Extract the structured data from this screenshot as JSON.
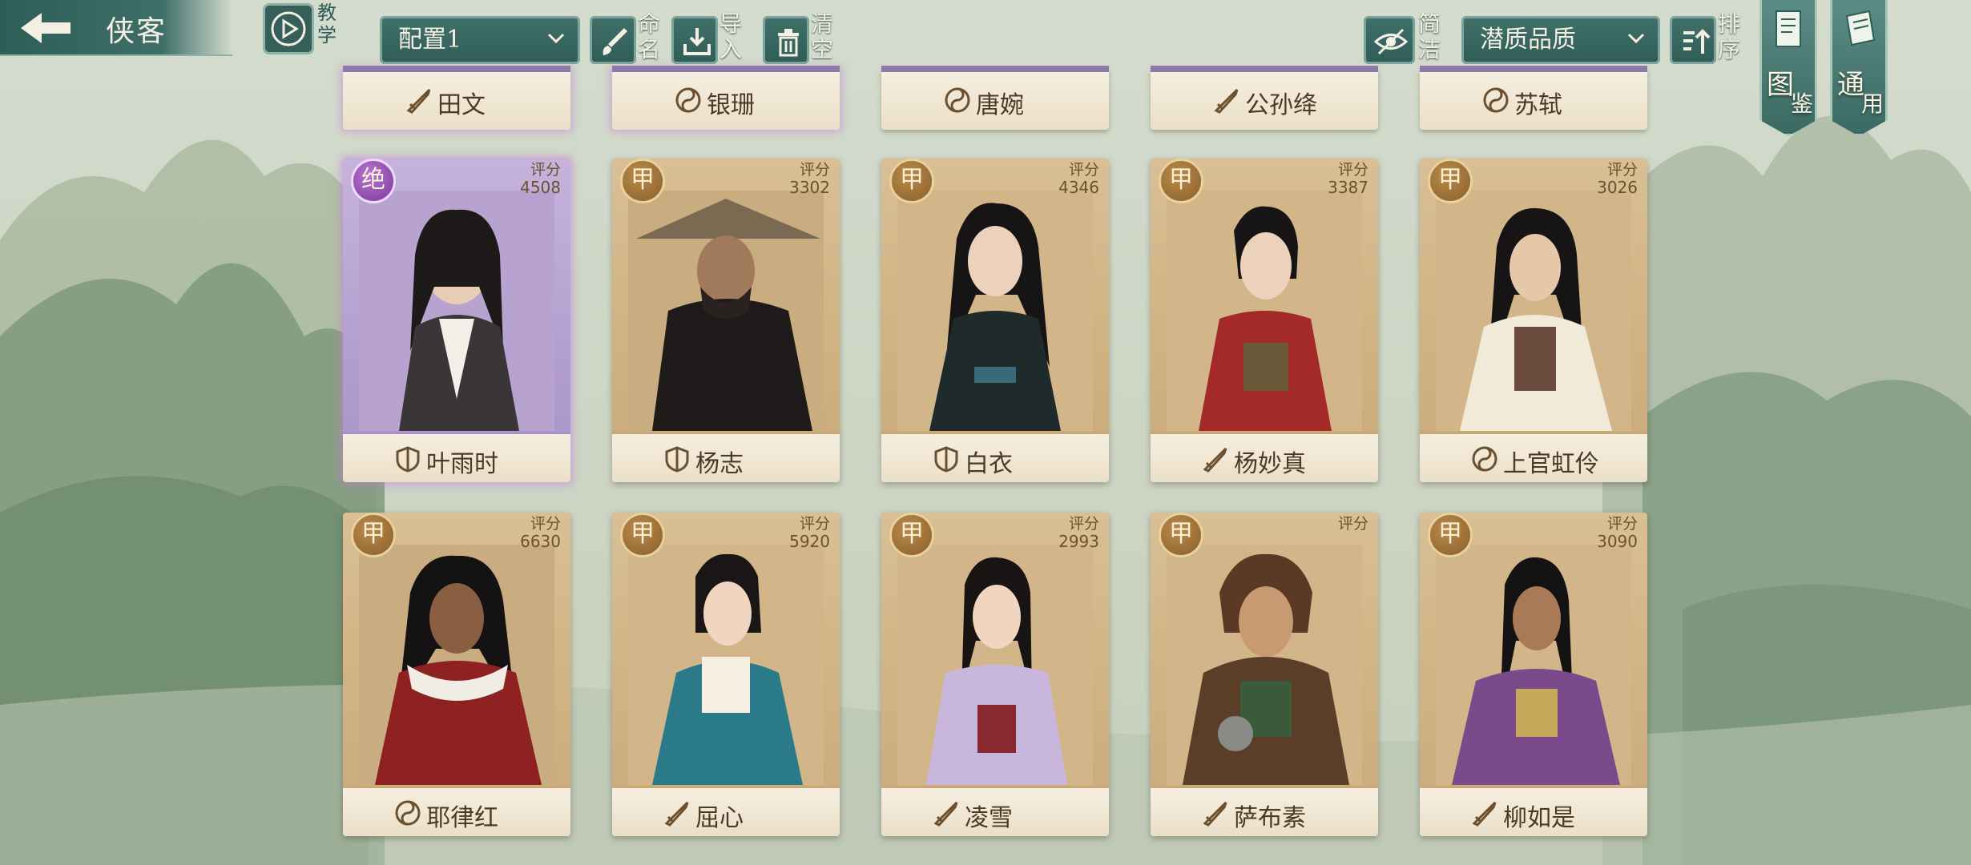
{
  "header": {
    "back_title": "侠客",
    "tutorial_label": "教学",
    "config_select": "配置1",
    "rename_label": "命名",
    "import_label": "导入",
    "clear_label": "清空",
    "simple_label": "简洁",
    "sort_select": "潜质品质",
    "sort_label": "排序",
    "atlas_label_1": "图",
    "atlas_label_2": "鉴",
    "general_label_1": "通",
    "general_label_2": "用"
  },
  "partial_row": [
    {
      "name": "田文",
      "icon": "sword-icon"
    },
    {
      "name": "银珊",
      "icon": "taiji-icon"
    },
    {
      "name": "唐婉",
      "icon": "taiji-icon"
    },
    {
      "name": "公孙绛",
      "icon": "sword-icon"
    },
    {
      "name": "苏轼",
      "icon": "taiji-icon"
    }
  ],
  "cards": [
    {
      "grade": "绝",
      "score_label": "评分",
      "score": "4508",
      "name": "叶雨时",
      "icon": "shield-icon",
      "rarity": "purple"
    },
    {
      "grade": "甲",
      "score_label": "评分",
      "score": "3302",
      "name": "杨志",
      "icon": "shield-icon",
      "rarity": "gold"
    },
    {
      "grade": "甲",
      "score_label": "评分",
      "score": "4346",
      "name": "白衣",
      "icon": "shield-icon",
      "rarity": "gold"
    },
    {
      "grade": "甲",
      "score_label": "评分",
      "score": "3387",
      "name": "杨妙真",
      "icon": "sword-icon",
      "rarity": "gold"
    },
    {
      "grade": "甲",
      "score_label": "评分",
      "score": "3026",
      "name": "上官虹伶",
      "icon": "taiji-icon",
      "rarity": "gold"
    },
    {
      "grade": "甲",
      "score_label": "评分",
      "score": "6630",
      "name": "耶律红",
      "icon": "taiji-icon",
      "rarity": "gold"
    },
    {
      "grade": "甲",
      "score_label": "评分",
      "score": "5920",
      "name": "屈心",
      "icon": "sword-icon",
      "rarity": "gold"
    },
    {
      "grade": "甲",
      "score_label": "评分",
      "score": "2993",
      "name": "凌雪",
      "icon": "sword-icon",
      "rarity": "gold"
    },
    {
      "grade": "甲",
      "score_label": "评分",
      "score": "",
      "name": "萨布素",
      "icon": "sword-icon",
      "rarity": "gold"
    },
    {
      "grade": "甲",
      "score_label": "评分",
      "score": "3090",
      "name": "柳如是",
      "icon": "sword-icon",
      "rarity": "gold"
    }
  ],
  "colors": {
    "teal": "#2f5d58",
    "gold_card": "#d9bf93",
    "purple_card": "#c6b3dc",
    "plate": "#f6efe0"
  }
}
